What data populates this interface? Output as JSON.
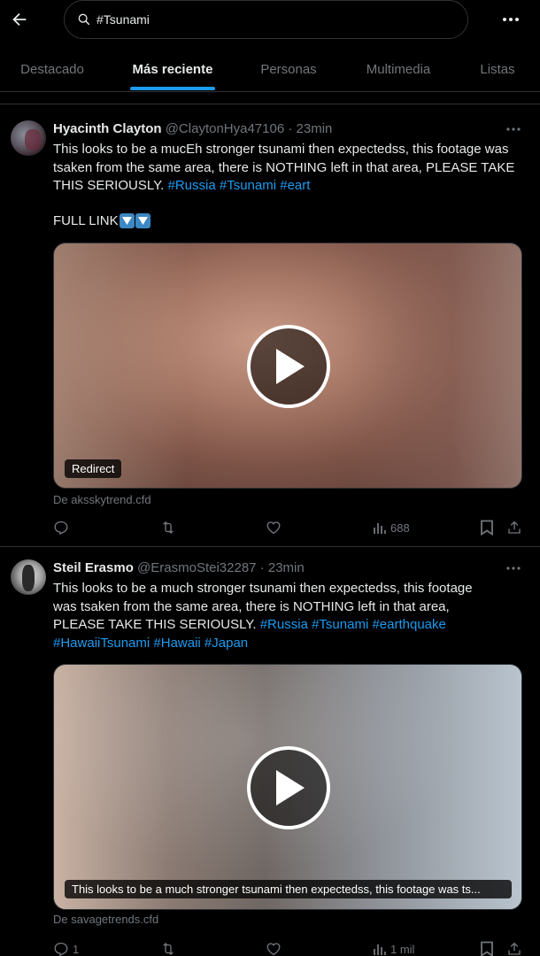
{
  "search": {
    "query": "#Tsunami"
  },
  "tabs": [
    {
      "label": "Destacado",
      "active": false
    },
    {
      "label": "Más reciente",
      "active": true
    },
    {
      "label": "Personas",
      "active": false
    },
    {
      "label": "Multimedia",
      "active": false
    },
    {
      "label": "Listas",
      "active": false
    }
  ],
  "tweets": [
    {
      "author": "Hyacinth Clayton",
      "handle": "@ClaytonHya47106",
      "time": "· 23min",
      "text_plain": "This looks to be a mucEh stronger tsunami then expectedss, this footage was tsaken from the same area, there is NOTHING left in that area, PLEASE TAKE THIS SERIOUSLY.",
      "hashtags": [
        "#Russia",
        "#Tsunami",
        "#eart"
      ],
      "extra_line": "FULL LINK",
      "media_badge": "Redirect",
      "source": "De aksskytrend.cfd",
      "counts": {
        "replies": "",
        "retweets": "",
        "likes": "",
        "views": "688"
      }
    },
    {
      "author": "Steil Erasmo",
      "handle": "@ErasmoStei32287",
      "time": "· 23min",
      "text_plain": "This looks to be a much stronger tsunami then expectedss, this footage was tsaken from the same area, there is NOTHING left in that area, PLEASE TAKE THIS SERIOUSLY.",
      "hashtags": [
        "#Russia",
        "#Tsunami",
        "#earthquake",
        "#HawaiiTsunami",
        "#Hawaii",
        "#Japan"
      ],
      "media_badge": "This looks to be a much stronger tsunami then expectedss, this footage was ts...",
      "source": "De savagetrends.cfd",
      "counts": {
        "replies": "1",
        "retweets": "",
        "likes": "",
        "views": "1 mil"
      }
    }
  ],
  "colors": {
    "background": "#000000",
    "text": "#e7e9ea",
    "muted": "#71767b",
    "accent": "#1d9bf0",
    "border": "#2f3336"
  },
  "icons": {
    "back": "arrow-left-icon",
    "search": "search-icon",
    "more": "more-horizontal-icon",
    "reply": "reply-icon",
    "retweet": "retweet-icon",
    "like": "heart-icon",
    "views": "views-bar-icon",
    "bookmark": "bookmark-icon",
    "share": "share-icon",
    "play": "play-icon",
    "arrow_down": "down-arrow-emoji-icon"
  }
}
